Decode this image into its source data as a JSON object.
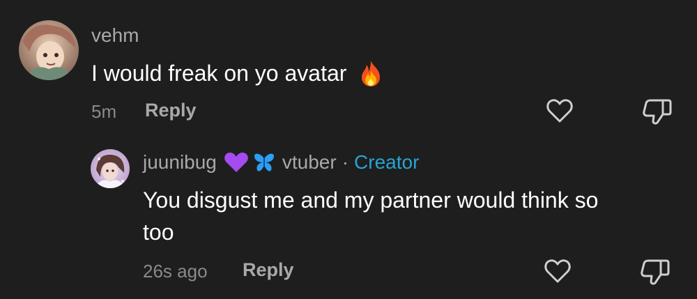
{
  "comment": {
    "username": "vehm",
    "text": "I would freak on yo avatar",
    "emoji_icon": "fire-emoji-icon",
    "time": "5m",
    "reply_label": "Reply"
  },
  "reply": {
    "username": "juunibug",
    "name_emojis": [
      "purple-heart-icon",
      "butterfly-icon"
    ],
    "tag": "vtuber",
    "separator": "·",
    "badge": "Creator",
    "text_line1": "You disgust me and my partner would think so",
    "text_line2": "too",
    "time": "26s ago",
    "reply_label": "Reply"
  },
  "colors": {
    "background": "#1e1e1e",
    "creator_badge": "#25a6d6",
    "muted_text": "#a9a9a9"
  }
}
